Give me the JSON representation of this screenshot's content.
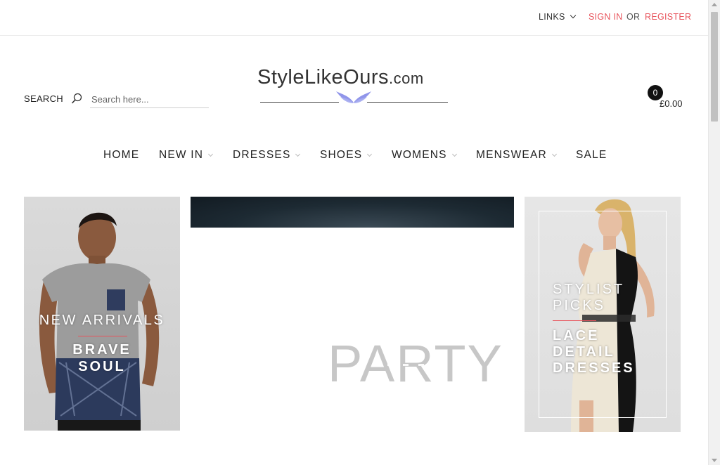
{
  "topbar": {
    "links_label": "LINKS",
    "sign_in": "SIGN IN",
    "or": "OR",
    "register": "REGISTER"
  },
  "header": {
    "search_label": "SEARCH",
    "search_placeholder": "Search here...",
    "logo_main": "StyleLikeOurs",
    "logo_suffix": ".com",
    "cart_count": "0",
    "cart_total": "£0.00"
  },
  "nav": {
    "items": [
      {
        "label": "HOME",
        "has_dropdown": false
      },
      {
        "label": "NEW IN",
        "has_dropdown": true
      },
      {
        "label": "DRESSES",
        "has_dropdown": true
      },
      {
        "label": "SHOES",
        "has_dropdown": true
      },
      {
        "label": "WOMENS",
        "has_dropdown": true
      },
      {
        "label": "MENSWEAR",
        "has_dropdown": true
      },
      {
        "label": "SALE",
        "has_dropdown": false
      }
    ]
  },
  "banners": {
    "left": {
      "title": "NEW ARRIVALS",
      "sub_line1": "BRAVE",
      "sub_line2": "SOUL"
    },
    "center": {
      "headline": "PARTY"
    },
    "right": {
      "title_line1": "STYLIST",
      "title_line2": "PICKS",
      "sub_line1": "LACE",
      "sub_line2": "DETAIL",
      "sub_line3": "DRESSES"
    }
  },
  "colors": {
    "accent": "#e8545c",
    "text": "#222222",
    "cart_badge": "#111111"
  }
}
